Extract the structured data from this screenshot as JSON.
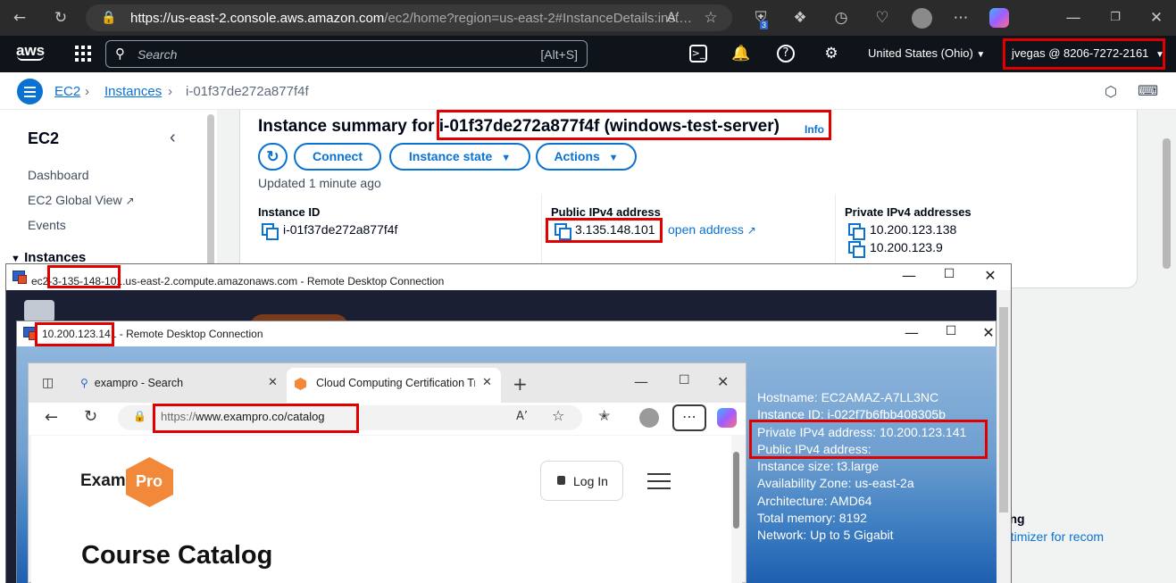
{
  "browser": {
    "url_host": "https://us-east-2.console.aws.amazon.com",
    "url_path": "/ec2/home?region=us-east-2#InstanceDetails:inst…",
    "reader_label": "A’",
    "badge_count": "3"
  },
  "aws_nav": {
    "logo": "aws",
    "search_placeholder": "Search",
    "search_shortcut": "[Alt+S]",
    "region": "United States (Ohio)",
    "account": "jvegas @ 8206-7272-2161"
  },
  "breadcrumb": {
    "ec2": "EC2",
    "instances": "Instances",
    "current": "i-01f37de272a877f4f"
  },
  "sidebar": {
    "title": "EC2",
    "items": [
      "Dashboard",
      "EC2 Global View",
      "Events"
    ],
    "section": "Instances"
  },
  "summary": {
    "title_prefix": "Instance summary for ",
    "title_instance": "i-01f37de272a877f4f (windows-test-server)",
    "info": "Info",
    "connect": "Connect",
    "instance_state": "Instance state",
    "actions": "Actions",
    "updated": "Updated 1 minute ago",
    "instance_id_label": "Instance ID",
    "instance_id": "i-01f37de272a877f4f",
    "public_ip_label": "Public IPv4 address",
    "public_ip": "3.135.148.101",
    "open_address": "open address",
    "private_ip_label": "Private IPv4 addresses",
    "private_ips": [
      "10.200.123.138",
      "10.200.123.9"
    ]
  },
  "background_right": {
    "heading_fragment": "ding",
    "link_fragment": "ptimizer for recom",
    "bracket": "]"
  },
  "rdp1": {
    "title_prefix": "ec2",
    "title_ip": "-3-135-148-101",
    "title_suffix": ".us-east-2.compute.amazonaws.com - Remote Desktop Connection"
  },
  "rdp2": {
    "title_ip": "10.200.123.141",
    "title_suffix": " - Remote Desktop Connection"
  },
  "bginfo": {
    "hostname": "Hostname: EC2AMAZ-A7LL3NC",
    "instance_id": "Instance ID: i-022f7b6fbb408305b",
    "private_ip": "Private IPv4 address: 10.200.123.141",
    "public_ip": "Public IPv4 address:",
    "size": "Instance size: t3.large",
    "az": "Availability Zone: us-east-2a",
    "arch": "Architecture: AMD64",
    "memory": "Total memory: 8192",
    "network": "Network: Up to 5 Gigabit"
  },
  "edge": {
    "tab1": "exampro - Search",
    "tab2": "Cloud Computing Certification Tra",
    "url_scheme": "https://",
    "url_rest": "www.exampro.co/catalog"
  },
  "site": {
    "exam": "Exam",
    "pro": "Pro",
    "login": "Log In",
    "heading": "Course Catalog"
  },
  "colors": {
    "aws_nav": "#0f141a",
    "aws_link": "#0972d3",
    "highlight": "#e00000",
    "exampro_orange": "#f2883a"
  }
}
